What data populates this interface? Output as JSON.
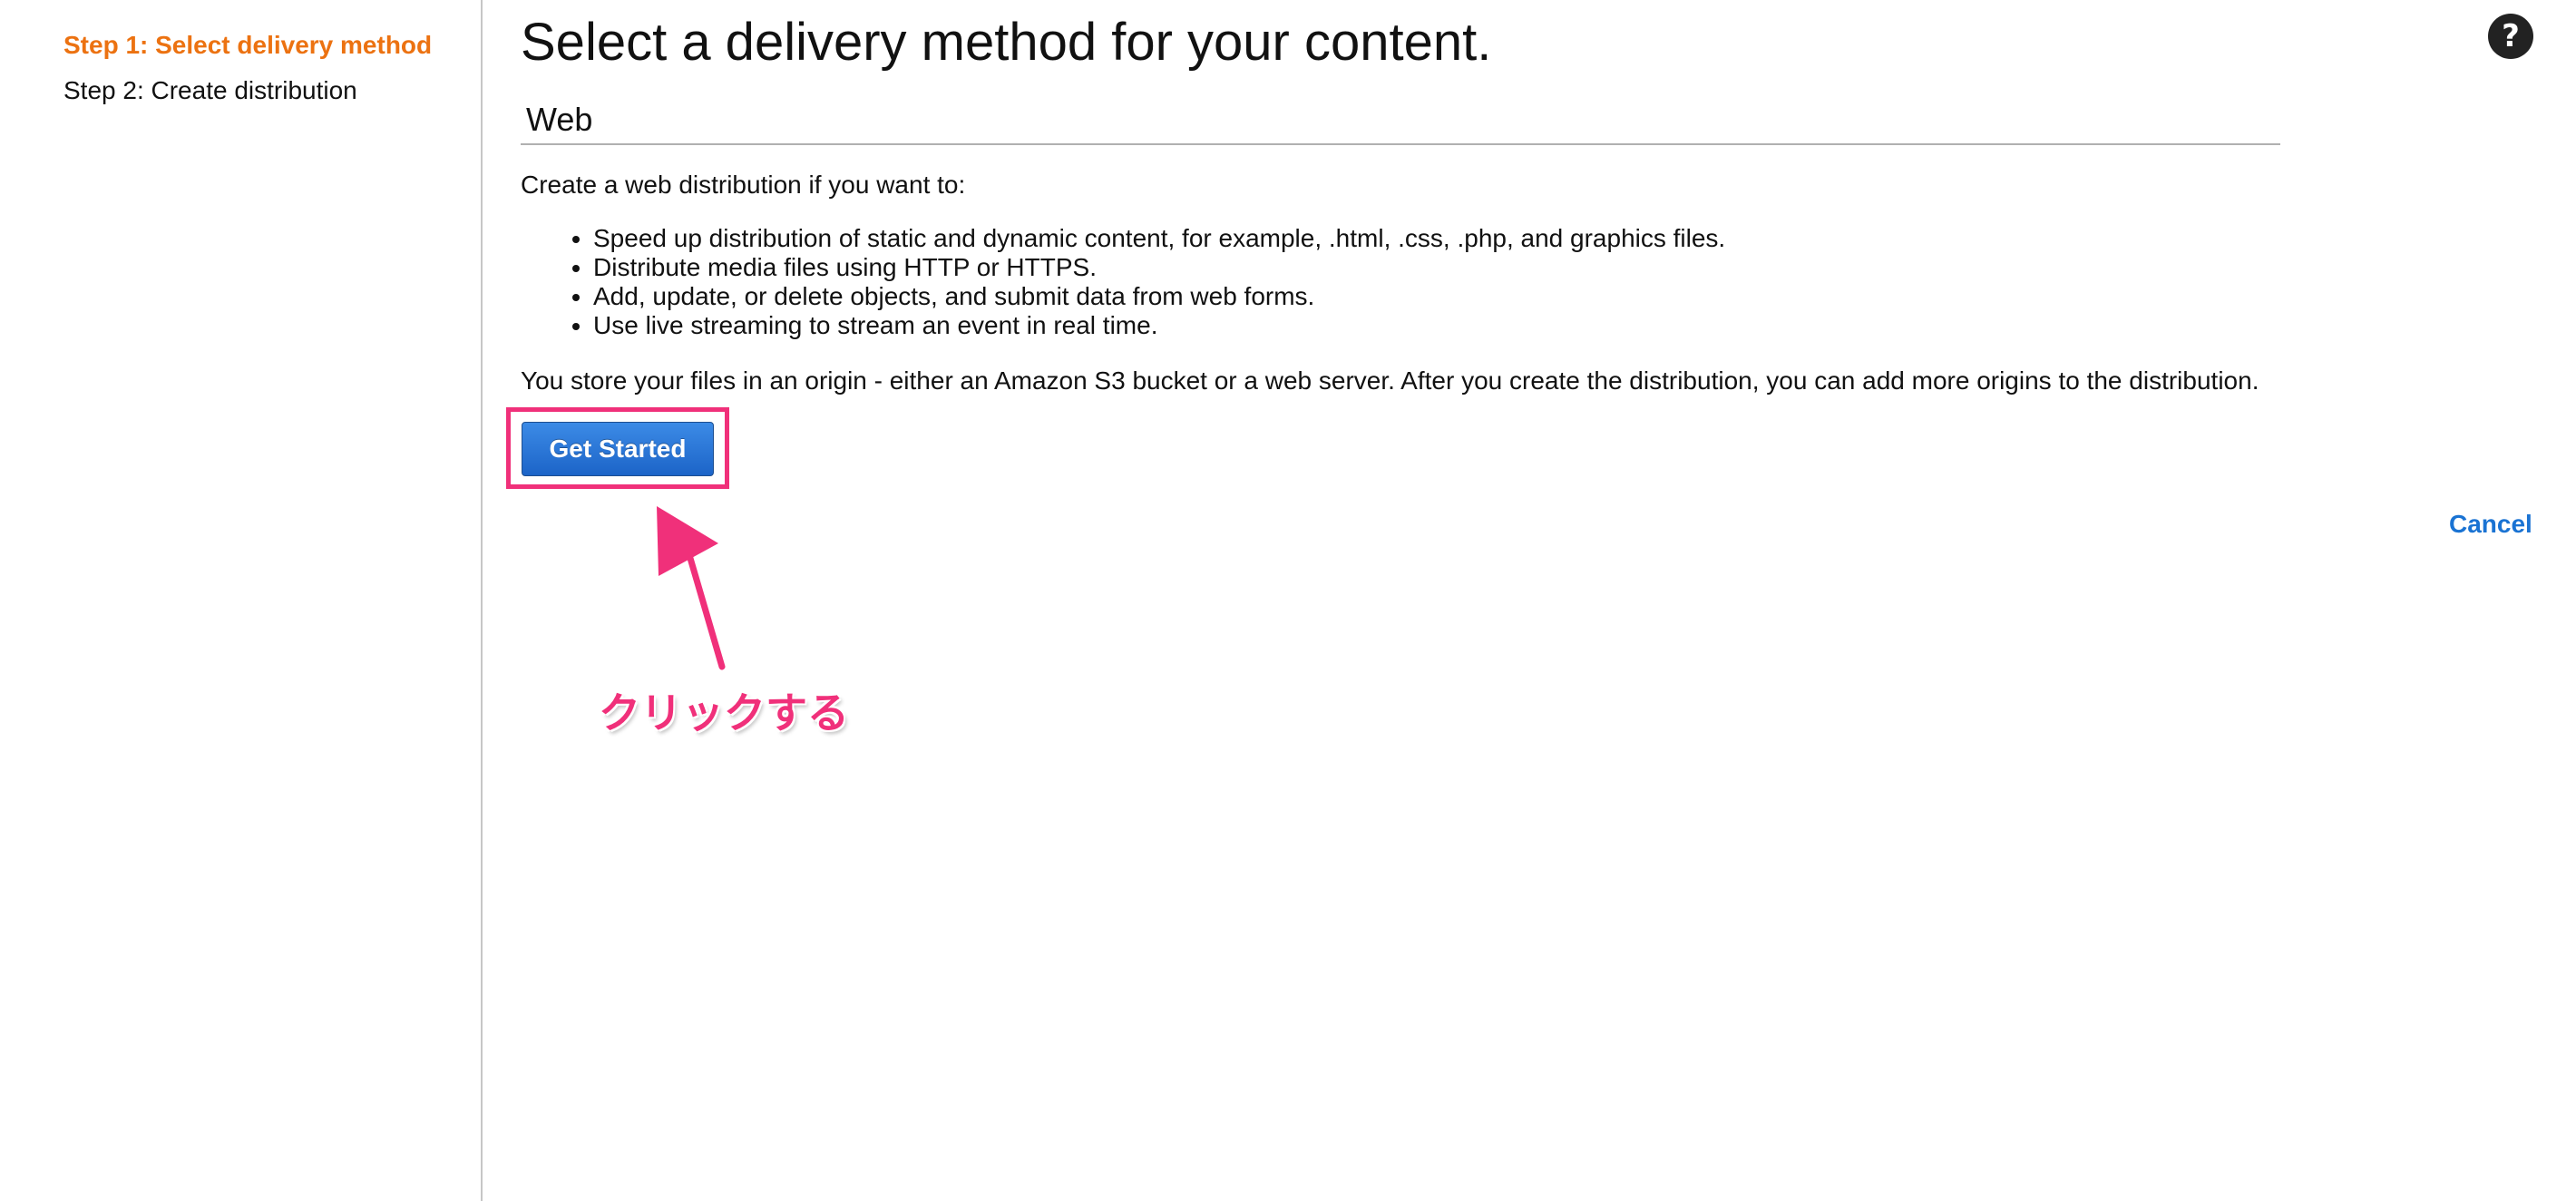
{
  "sidebar": {
    "steps": [
      {
        "label": "Step 1: Select delivery method",
        "active": true
      },
      {
        "label": "Step 2: Create distribution",
        "active": false
      }
    ]
  },
  "main": {
    "title": "Select a delivery method for your content.",
    "section_heading": "Web",
    "intro": "Create a web distribution if you want to:",
    "bullets": [
      "Speed up distribution of static and dynamic content, for example, .html, .css, .php, and graphics files.",
      "Distribute media files using HTTP or HTTPS.",
      "Add, update, or delete objects, and submit data from web forms.",
      "Use live streaming to stream an event in real time."
    ],
    "origin_note": "You store your files in an origin - either an Amazon S3 bucket or a web server. After you create the distribution, you can add more origins to the distribution.",
    "get_started_label": "Get Started",
    "cancel_label": "Cancel"
  },
  "icons": {
    "help": "question-circle-icon"
  },
  "annotation": {
    "label": "クリックする"
  },
  "colors": {
    "active_step": "#ec7211",
    "primary_button": "#1c64c8",
    "link": "#1a73d3",
    "annotation": "#f0307a"
  }
}
